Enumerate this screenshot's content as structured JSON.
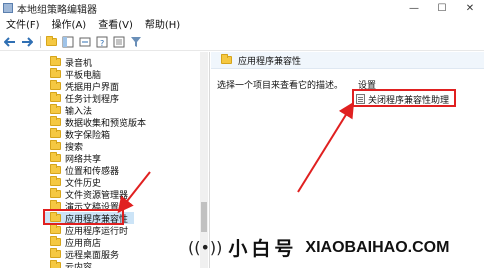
{
  "window": {
    "title": "本地组策略编辑器",
    "minimize": "—",
    "maximize": "☐",
    "close": "✕"
  },
  "menu": [
    "文件(F)",
    "操作(A)",
    "查看(V)",
    "帮助(H)"
  ],
  "toolbar": {
    "icons": [
      "back-icon",
      "forward-icon",
      "up-folder-icon",
      "view-icon",
      "export-icon",
      "help-icon",
      "view2-icon",
      "filter-icon"
    ]
  },
  "tree": {
    "items": [
      {
        "label": "录音机"
      },
      {
        "label": "平板电脑"
      },
      {
        "label": "凭据用户界面"
      },
      {
        "label": "任务计划程序"
      },
      {
        "label": "输入法"
      },
      {
        "label": "数据收集和预览版本"
      },
      {
        "label": "数字保险箱"
      },
      {
        "label": "搜索"
      },
      {
        "label": "网络共享"
      },
      {
        "label": "位置和传感器"
      },
      {
        "label": "文件历史"
      },
      {
        "label": "文件资源管理器"
      },
      {
        "label": "演示文稿设置"
      },
      {
        "label": "应用程序兼容性",
        "selected": true
      },
      {
        "label": "应用程序运行时"
      },
      {
        "label": "应用商店"
      },
      {
        "label": "远程桌面服务"
      },
      {
        "label": "云内容"
      }
    ]
  },
  "right_pane": {
    "header_title": "应用程序兼容性",
    "description": "选择一个项目来查看它的描述。",
    "column_header": "设置",
    "settings": [
      {
        "label": "关闭程序兼容性助理"
      }
    ]
  },
  "watermark": {
    "icon": "((•))",
    "brand": "小白号",
    "domain": "XIAOBAIHAO.COM"
  },
  "colors": {
    "highlight": "#e02020",
    "selection": "#cce4f7",
    "folder": "#f5c842"
  }
}
